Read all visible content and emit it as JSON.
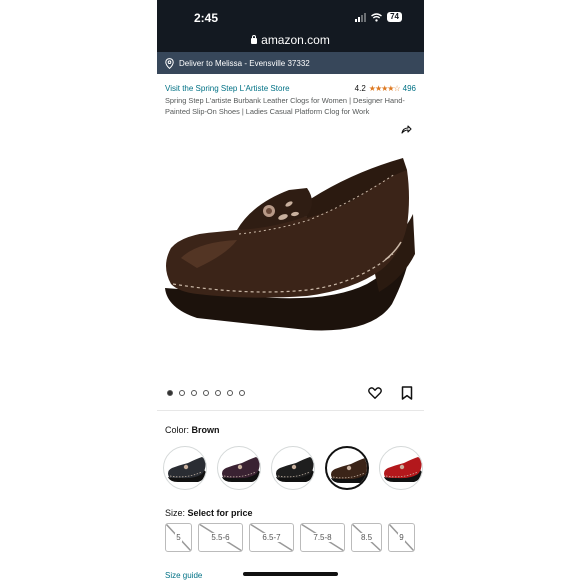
{
  "status_bar": {
    "time": "2:45",
    "battery": "74"
  },
  "browser": {
    "url": "amazon.com"
  },
  "delivery": {
    "text": "Deliver to Melissa - Evensville 37332",
    "icon": "location-pin-icon"
  },
  "product": {
    "store_link": "Visit the Spring Step L'Artiste Store",
    "rating": "4.2",
    "stars": "★★★★☆",
    "rating_count": "496",
    "title": "Spring Step L'artiste Burbank Leather Clogs for Women | Designer Hand-Painted Slip-On Shoes | Ladies Casual Platform Clog for Work"
  },
  "gallery": {
    "image_count": 7,
    "active_index": 0
  },
  "color": {
    "label": "Color:",
    "selected": "Brown",
    "swatches": [
      {
        "name": "Black",
        "hex": "#2a2d33"
      },
      {
        "name": "Plum",
        "hex": "#3a2232"
      },
      {
        "name": "Black Multi",
        "hex": "#1e1e1e"
      },
      {
        "name": "Brown",
        "hex": "#3b2418"
      },
      {
        "name": "Red",
        "hex": "#b3181c"
      }
    ]
  },
  "size": {
    "label": "Size:",
    "selected": "Select for price",
    "options": [
      "5",
      "5.5-6",
      "6.5-7",
      "7.5-8",
      "8.5",
      "9"
    ]
  },
  "links": {
    "size_guide": "Size guide"
  },
  "colors": {
    "header_bg": "#131921",
    "deliver_bg": "#37475a",
    "link": "#007185",
    "star": "#de7921"
  }
}
